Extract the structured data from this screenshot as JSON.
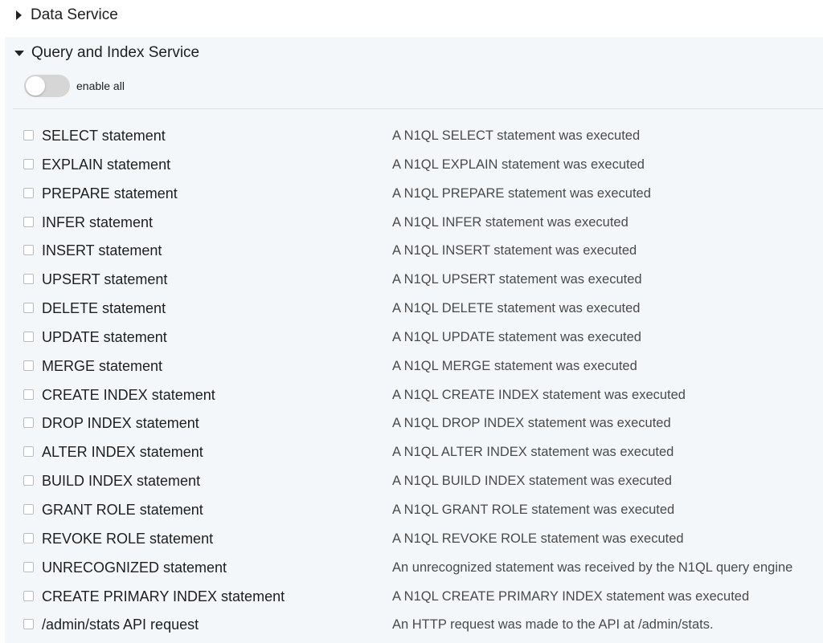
{
  "sections": {
    "data_service": {
      "title": "Data Service",
      "expanded": false
    },
    "query_index": {
      "title": "Query and Index Service",
      "expanded": true,
      "enable_all": {
        "label": "enable all",
        "on": false
      },
      "events": [
        {
          "name": "SELECT statement",
          "description": "A N1QL SELECT statement was executed",
          "checked": false
        },
        {
          "name": "EXPLAIN statement",
          "description": "A N1QL EXPLAIN statement was executed",
          "checked": false
        },
        {
          "name": "PREPARE statement",
          "description": "A N1QL PREPARE statement was executed",
          "checked": false
        },
        {
          "name": "INFER statement",
          "description": "A N1QL INFER statement was executed",
          "checked": false
        },
        {
          "name": "INSERT statement",
          "description": "A N1QL INSERT statement was executed",
          "checked": false
        },
        {
          "name": "UPSERT statement",
          "description": "A N1QL UPSERT statement was executed",
          "checked": false
        },
        {
          "name": "DELETE statement",
          "description": "A N1QL DELETE statement was executed",
          "checked": false
        },
        {
          "name": "UPDATE statement",
          "description": "A N1QL UPDATE statement was executed",
          "checked": false
        },
        {
          "name": "MERGE statement",
          "description": "A N1QL MERGE statement was executed",
          "checked": false
        },
        {
          "name": "CREATE INDEX statement",
          "description": "A N1QL CREATE INDEX statement was executed",
          "checked": false
        },
        {
          "name": "DROP INDEX statement",
          "description": "A N1QL DROP INDEX statement was executed",
          "checked": false
        },
        {
          "name": "ALTER INDEX statement",
          "description": "A N1QL ALTER INDEX statement was executed",
          "checked": false
        },
        {
          "name": "BUILD INDEX statement",
          "description": "A N1QL BUILD INDEX statement was executed",
          "checked": false
        },
        {
          "name": "GRANT ROLE statement",
          "description": "A N1QL GRANT ROLE statement was executed",
          "checked": false
        },
        {
          "name": "REVOKE ROLE statement",
          "description": "A N1QL REVOKE ROLE statement was executed",
          "checked": false
        },
        {
          "name": "UNRECOGNIZED statement",
          "description": "An unrecognized statement was received by the N1QL query engine",
          "checked": false
        },
        {
          "name": "CREATE PRIMARY INDEX statement",
          "description": "A N1QL CREATE PRIMARY INDEX statement was executed",
          "checked": false
        },
        {
          "name": "/admin/stats API request",
          "description": "An HTTP request was made to the API at /admin/stats.",
          "checked": false
        }
      ]
    }
  },
  "icons": {
    "collapsed": "caret-right-icon",
    "expanded": "caret-down-icon"
  },
  "colors": {
    "panel_background": "#f4f7fa",
    "toggle_off": "#d6d6d6",
    "description_text": "#4a4a4a"
  }
}
